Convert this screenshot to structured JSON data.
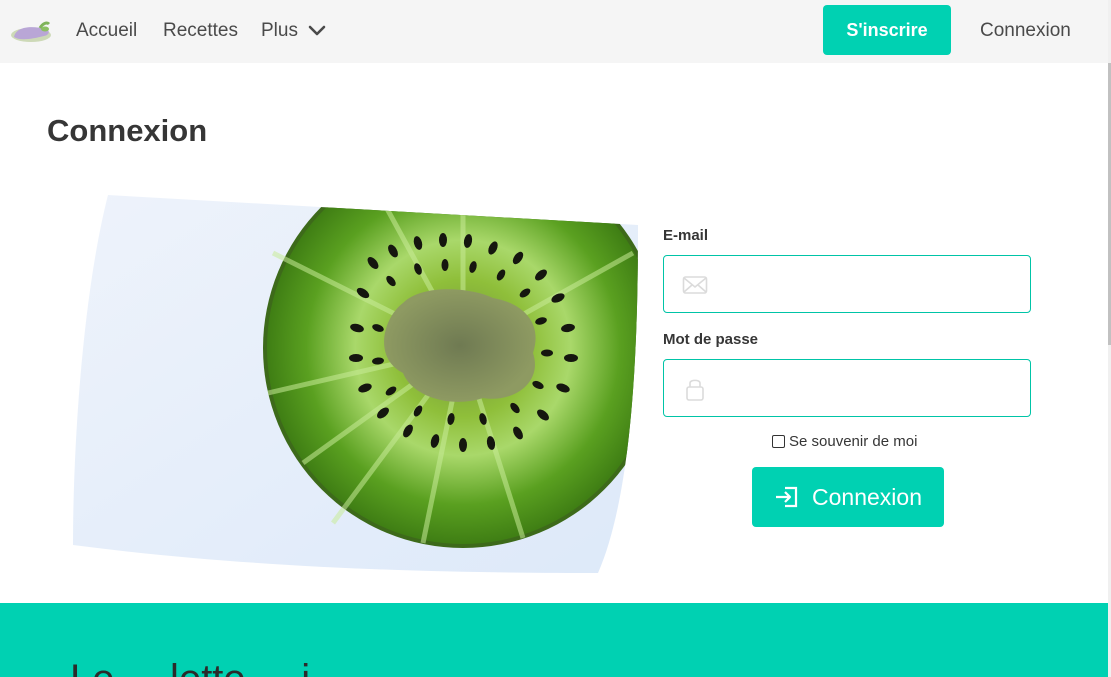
{
  "navbar": {
    "logo_icon": "eggplant-logo",
    "items": [
      {
        "label": "Accueil"
      },
      {
        "label": "Recettes"
      },
      {
        "label": "Plus",
        "icon": "chevron-down-icon"
      }
    ],
    "signup_label": "S'inscrire",
    "login_label": "Connexion"
  },
  "page": {
    "title": "Connexion"
  },
  "form": {
    "email_label": "E-mail",
    "email_value": "",
    "email_icon": "envelope-icon",
    "password_label": "Mot de passe",
    "password_value": "",
    "password_icon": "lock-icon",
    "remember_label": "Se souvenir de moi",
    "remember_checked": false,
    "submit_label": "Connexion",
    "submit_icon": "sign-in-icon"
  },
  "hero": {
    "image": "kiwi-slice"
  },
  "band": {
    "heading_partial": "Le ... lette ... i"
  },
  "colors": {
    "accent": "#00d1b2",
    "navbar_bg": "#f5f5f5",
    "hero_bg": "#e3edfa"
  }
}
